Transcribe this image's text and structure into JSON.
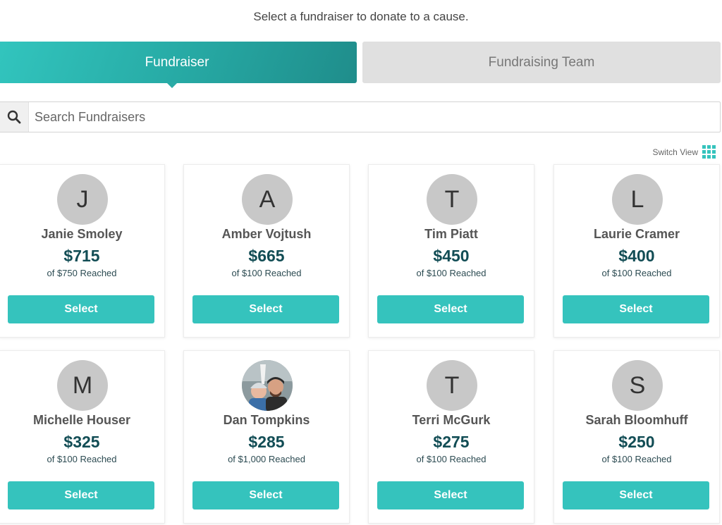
{
  "intro_text": "Select a fundraiser to donate to a cause.",
  "tabs": [
    {
      "label": "Fundraiser",
      "active": true
    },
    {
      "label": "Fundraising Team",
      "active": false
    }
  ],
  "search": {
    "placeholder": "Search Fundraisers",
    "value": ""
  },
  "switch_view_label": "Switch View",
  "colors": {
    "accent": "#35c3bd",
    "amount": "#124d55",
    "avatar_bg": "#c8c8c8"
  },
  "fundraisers": [
    {
      "initial": "J",
      "name": "Janie Smoley",
      "amount": "$715",
      "goal": "of $750 Reached",
      "select_label": "Select"
    },
    {
      "initial": "A",
      "name": "Amber Vojtush",
      "amount": "$665",
      "goal": "of $100 Reached",
      "select_label": "Select"
    },
    {
      "initial": "T",
      "name": "Tim Piatt",
      "amount": "$450",
      "goal": "of $100 Reached",
      "select_label": "Select"
    },
    {
      "initial": "L",
      "name": "Laurie Cramer",
      "amount": "$400",
      "goal": "of $100 Reached",
      "select_label": "Select"
    },
    {
      "initial": "M",
      "name": "Michelle Houser",
      "amount": "$325",
      "goal": "of $100 Reached",
      "select_label": "Select"
    },
    {
      "initial": "",
      "name": "Dan Tompkins",
      "amount": "$285",
      "goal": "of $1,000 Reached",
      "select_label": "Select",
      "photo": true
    },
    {
      "initial": "T",
      "name": "Terri McGurk",
      "amount": "$275",
      "goal": "of $100 Reached",
      "select_label": "Select"
    },
    {
      "initial": "S",
      "name": "Sarah Bloomhuff",
      "amount": "$250",
      "goal": "of $100 Reached",
      "select_label": "Select"
    }
  ]
}
